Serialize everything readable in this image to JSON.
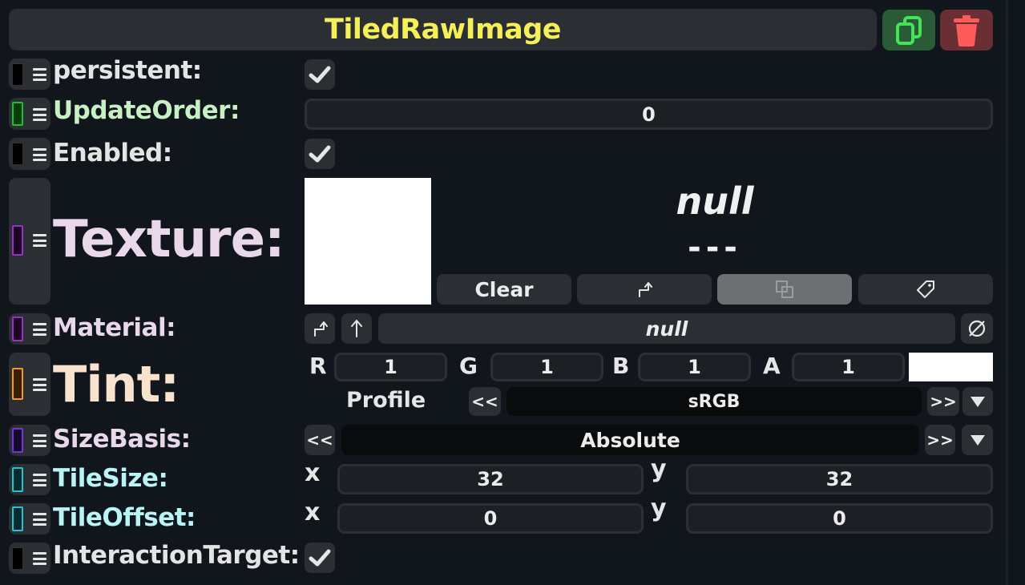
{
  "header": {
    "title": "TiledRawImage"
  },
  "fields": {
    "persistent": "persistent:",
    "update_order": "UpdateOrder:",
    "enabled": "Enabled:",
    "texture": "Texture:",
    "material": "Material:",
    "tint": "Tint:",
    "size_basis": "SizeBasis:",
    "tile_size": "TileSize:",
    "tile_offset": "TileOffset:",
    "interaction_target": "InteractionTarget:"
  },
  "update_order_value": "0",
  "texture": {
    "name": "null",
    "dashes": "---",
    "clear_label": "Clear"
  },
  "material": {
    "value": "null"
  },
  "tint": {
    "r_label": "R",
    "r": "1",
    "g_label": "G",
    "g": "1",
    "b_label": "B",
    "b": "1",
    "a_label": "A",
    "a": "1",
    "profile_label": "Profile",
    "profile_value": "sRGB",
    "prev": "<<",
    "next": ">>"
  },
  "size_basis": {
    "value": "Absolute",
    "prev": "<<",
    "next": ">>"
  },
  "tile_size": {
    "x_label": "x",
    "x": "32",
    "y_label": "y",
    "y": "32"
  },
  "tile_offset": {
    "x_label": "x",
    "x": "0",
    "y_label": "y",
    "y": "0"
  },
  "colors": {
    "title": "#f5f05a",
    "update_order_label": "#c9f0c5",
    "texture_label": "#e8d8ea",
    "tint_label": "#f9e3cf",
    "tile_label": "#b9f4f6",
    "swatch_purple": "#9b30c9",
    "swatch_green": "#19c22a",
    "swatch_orange": "#f59a1a",
    "swatch_cyan": "#1fc6d0",
    "swatch_violet": "#7436d9"
  },
  "icons": {
    "duplicate": "duplicate-icon",
    "delete": "trash-icon",
    "jump": "jump-to-icon",
    "copy": "copy-icon",
    "tag": "tag-icon",
    "up": "arrow-up-icon",
    "clear_ref": "null-set-icon",
    "dropdown": "dropdown-triangle-icon",
    "check": "checkmark-icon"
  }
}
